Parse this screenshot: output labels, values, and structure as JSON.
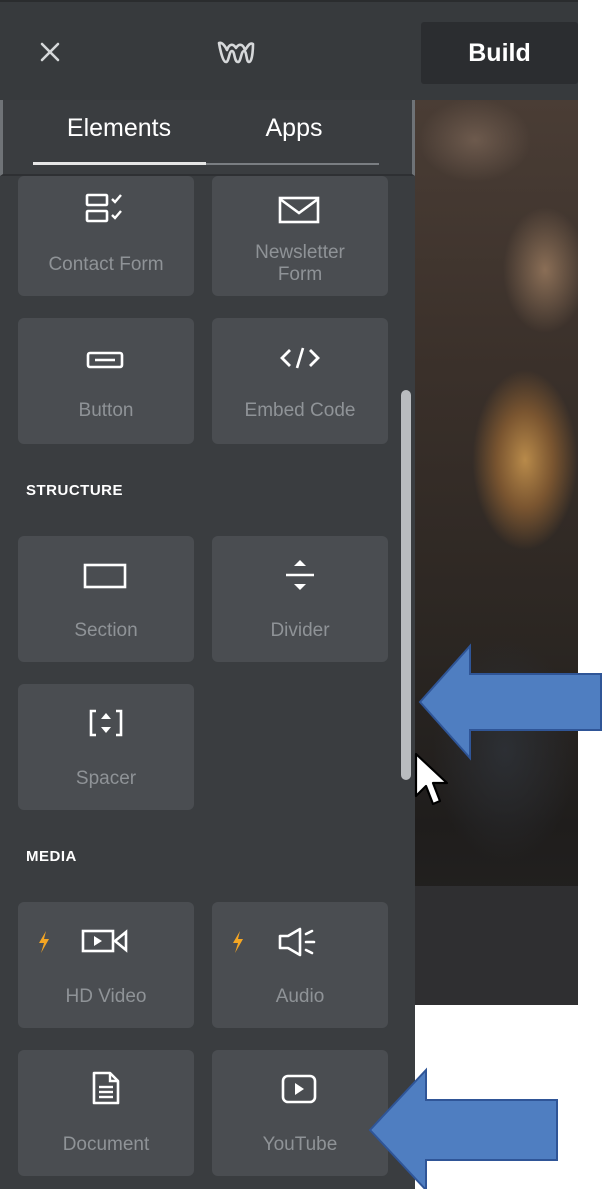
{
  "topbar": {
    "close_icon": "close-icon",
    "logo_icon": "weebly-logo-icon",
    "build_label": "Build"
  },
  "panel": {
    "tabs": [
      {
        "label": "Elements",
        "active": true
      },
      {
        "label": "Apps",
        "active": false
      }
    ],
    "tiles": {
      "contact_form": {
        "label": "Contact Form",
        "icon": "contact-form-icon"
      },
      "newsletter_form": {
        "label_line1": "Newsletter",
        "label_line2": "Form",
        "icon": "envelope-icon"
      },
      "button": {
        "label": "Button",
        "icon": "button-icon"
      },
      "embed_code": {
        "label": "Embed Code",
        "icon": "code-icon"
      },
      "section": {
        "label": "Section",
        "icon": "section-icon"
      },
      "divider": {
        "label": "Divider",
        "icon": "divider-icon"
      },
      "spacer": {
        "label": "Spacer",
        "icon": "spacer-icon"
      },
      "hd_video": {
        "label": "HD Video",
        "icon": "video-camera-icon",
        "premium": true
      },
      "audio": {
        "label": "Audio",
        "icon": "speaker-icon",
        "premium": true
      },
      "document": {
        "label": "Document",
        "icon": "document-icon"
      },
      "youtube": {
        "label": "YouTube",
        "icon": "youtube-play-icon"
      }
    },
    "sections": {
      "structure": "STRUCTURE",
      "media": "MEDIA"
    }
  },
  "colors": {
    "panel_bg": "#3a3d40",
    "tile_bg": "#4a4d51",
    "tile_label": "#8f9397",
    "premium_bolt": "#f5a623",
    "annotation_arrow": "#4f7ec1"
  }
}
